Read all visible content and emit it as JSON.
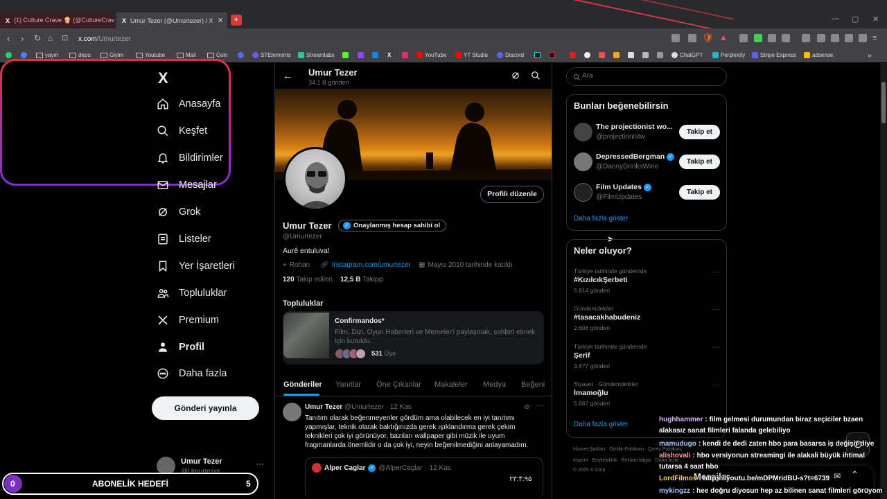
{
  "browser": {
    "tabs": [
      {
        "title": "(1) Culture Crave 🍿 (@CultureCrave"
      },
      {
        "title": "Umur Tezer (@Umurtezer) / X"
      }
    ],
    "url_host": "x.com",
    "url_path": "/Umurtezer",
    "bookmarks": [
      "yayın",
      "depo",
      "Giyim",
      "Youtube",
      "Mail",
      "Coin",
      "STElements",
      "Streamlabs",
      "YouTube",
      "YT Studio",
      "Discord",
      "ChatGPT",
      "Perplexity",
      "Stripe Express",
      "adsense"
    ],
    "bookmarks_more": "»"
  },
  "nav": {
    "logo": "X",
    "items": [
      {
        "label": "Anasayfa",
        "icon": "home-icon"
      },
      {
        "label": "Keşfet",
        "icon": "search-icon"
      },
      {
        "label": "Bildirimler",
        "icon": "bell-icon"
      },
      {
        "label": "Mesajlar",
        "icon": "mail-icon"
      },
      {
        "label": "Grok",
        "icon": "grok-icon"
      },
      {
        "label": "Listeler",
        "icon": "list-icon"
      },
      {
        "label": "Yer İşaretleri",
        "icon": "bookmark-icon"
      },
      {
        "label": "Topluluklar",
        "icon": "communities-icon"
      },
      {
        "label": "Premium",
        "icon": "x-premium-icon"
      },
      {
        "label": "Profil",
        "icon": "profile-icon"
      },
      {
        "label": "Daha fazla",
        "icon": "more-circle-icon"
      }
    ],
    "post_button": "Gönderi yayınla",
    "account_name": "Umur Tezer",
    "account_handle": "@Umurtezer"
  },
  "profile": {
    "header_name": "Umur Tezer",
    "post_count": "34,1 B gönderi",
    "edit_button": "Profili düzenle",
    "name": "Umur Tezer",
    "verify_badge": "Onaylanmış hesap sahibi ol",
    "handle": "@Umurtezer",
    "bio": "Aurê entuluva!",
    "location": "Rohan",
    "link": "Instagram.com/umurtezer",
    "joined": "Mayıs 2010 tarihinde katıldı",
    "following_count": "120",
    "following_label": "Takip edilen",
    "followers_count": "12,5 B",
    "followers_label": "Takipçi",
    "communities_title": "Topluluklar",
    "community": {
      "name": "Confirmandos*",
      "description": "Film, Dizi, Oyun Haberleri ve Memeler'i paylaşmak, sohbet etmek için kuruldu.",
      "members_count": "531",
      "members_label": "Üye"
    },
    "tabs": [
      "Gönderiler",
      "Yanıtlar",
      "Öne Çıkanlar",
      "Makaleler",
      "Medya",
      "Beğeni"
    ]
  },
  "tweet": {
    "author": "Umur Tezer",
    "handle": "@Umurtezer",
    "date": "· 12 Kas",
    "text": "Tanıtım olarak beğenmeyenler gördüm ama olabilecek en iyi tanıtımı yapmışlar, teknik olarak baktığınızda gerek ışıklandırma gerek çekim teknikleri çok iyi görünüyor, bazıları wallpaper gibi müzik ile uyum fragmanlarda önemlidir o da çok iyi, neyin beğenilmediğini anlayamadım.",
    "quoted_author": "Alper Caglar",
    "quoted_handle": "@AlperCaglar",
    "quoted_date": "· 12 Kas",
    "quoted_text": "۲۳:۴:۹۵"
  },
  "sidebar": {
    "search_placeholder": "Ara",
    "suggest_title": "Bunları beğenebilirsin",
    "suggestions": [
      {
        "name": "The projectionist wo...",
        "handle": "@projectionistw",
        "verified": false
      },
      {
        "name": "DepressedBergman",
        "handle": "@DannyDrinksWine",
        "verified": true
      },
      {
        "name": "Film Updates",
        "handle": "@FilmUpdates",
        "verified": true
      }
    ],
    "follow_label": "Takip et",
    "show_more": "Daha fazla göster",
    "trends_title": "Neler oluyor?",
    "trends": [
      {
        "meta": "Türkiye tarihinde gündemde",
        "name": "#KızılcıkŞerbeti",
        "count": "5.814 gönderi"
      },
      {
        "meta": "Gündemdekiler",
        "name": "#tasacakhabudeniz",
        "count": "2.606 gönderi"
      },
      {
        "meta": "Türkiye tarihinde gündemde",
        "name": "Şerif",
        "count": "3.677 gönderi"
      },
      {
        "meta": "Siyaset · Gündemdekiler",
        "name": "İmamoğlu",
        "count": "5.667 gönderi"
      }
    ],
    "trends_more": "Daha fazla göster",
    "footer_line1": "Hizmet Şartları   Gizlilik Politikası   Çerez Politikası",
    "footer_line2": "Imprint   Erişilebilirlik   Reklam bilgisi   Daha fazla ...",
    "footer_line3": "© 2025 X Corp.",
    "messages_label": "Mesajlar"
  },
  "overlay": {
    "goal_left": "0",
    "goal_label": "ABONELİK HEDEFİ",
    "goal_right": "5",
    "chat": [
      {
        "user": "hughhammer",
        "text": ": film gelmesi durumundan biraz seçiciler bzaen",
        "color": "#d9b3ff"
      },
      {
        "user": "",
        "text": "alakasız sanat filmleri falanda gelebiliyo",
        "color": "#ffffff"
      },
      {
        "user": "mamudugo",
        "text": ": kendi de dedi zaten hbo para basarsa iş değişir diye",
        "color": "#a8c8ff"
      },
      {
        "user": "alishovali",
        "text": ": hbo versiyonun streamingi ile alakali büyük ihtimal",
        "color": "#ff9b9b"
      },
      {
        "user": "",
        "text": "tutarsa 4 saat hbo",
        "color": "#ffffff"
      },
      {
        "user": "LordFilmos",
        "text": ": https://youtu.be/mDPMridBU-s?t=6739",
        "color": "#ffd24d"
      },
      {
        "user": "mykingzz",
        "text": ": hee doğru diyosun hep az bilinen sanat filmleri görüyom",
        "color": "#a8c8ff"
      }
    ]
  },
  "colors": {
    "accent": "#1d9bf0",
    "tab_underline": "#1d9bf0",
    "overlay_border_top": "#e0304a",
    "overlay_border_bottom": "#8a2be2"
  }
}
